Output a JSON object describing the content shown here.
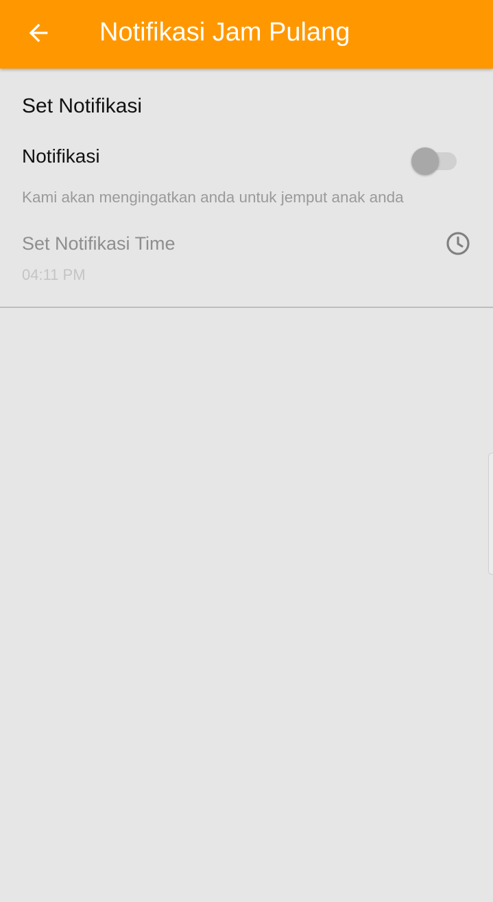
{
  "app_bar": {
    "title": "Notifikasi Jam Pulang",
    "back_icon": "arrow-left-icon",
    "background_color": "#ff9800"
  },
  "settings": {
    "section_title": "Set Notifikasi",
    "notification": {
      "label": "Notifikasi",
      "summary": "Kami akan mengingatkan anda untuk jemput anak anda",
      "enabled": false
    },
    "time": {
      "label": "Set Notifikasi Time",
      "value": "04:11 PM",
      "icon": "clock-icon"
    }
  }
}
